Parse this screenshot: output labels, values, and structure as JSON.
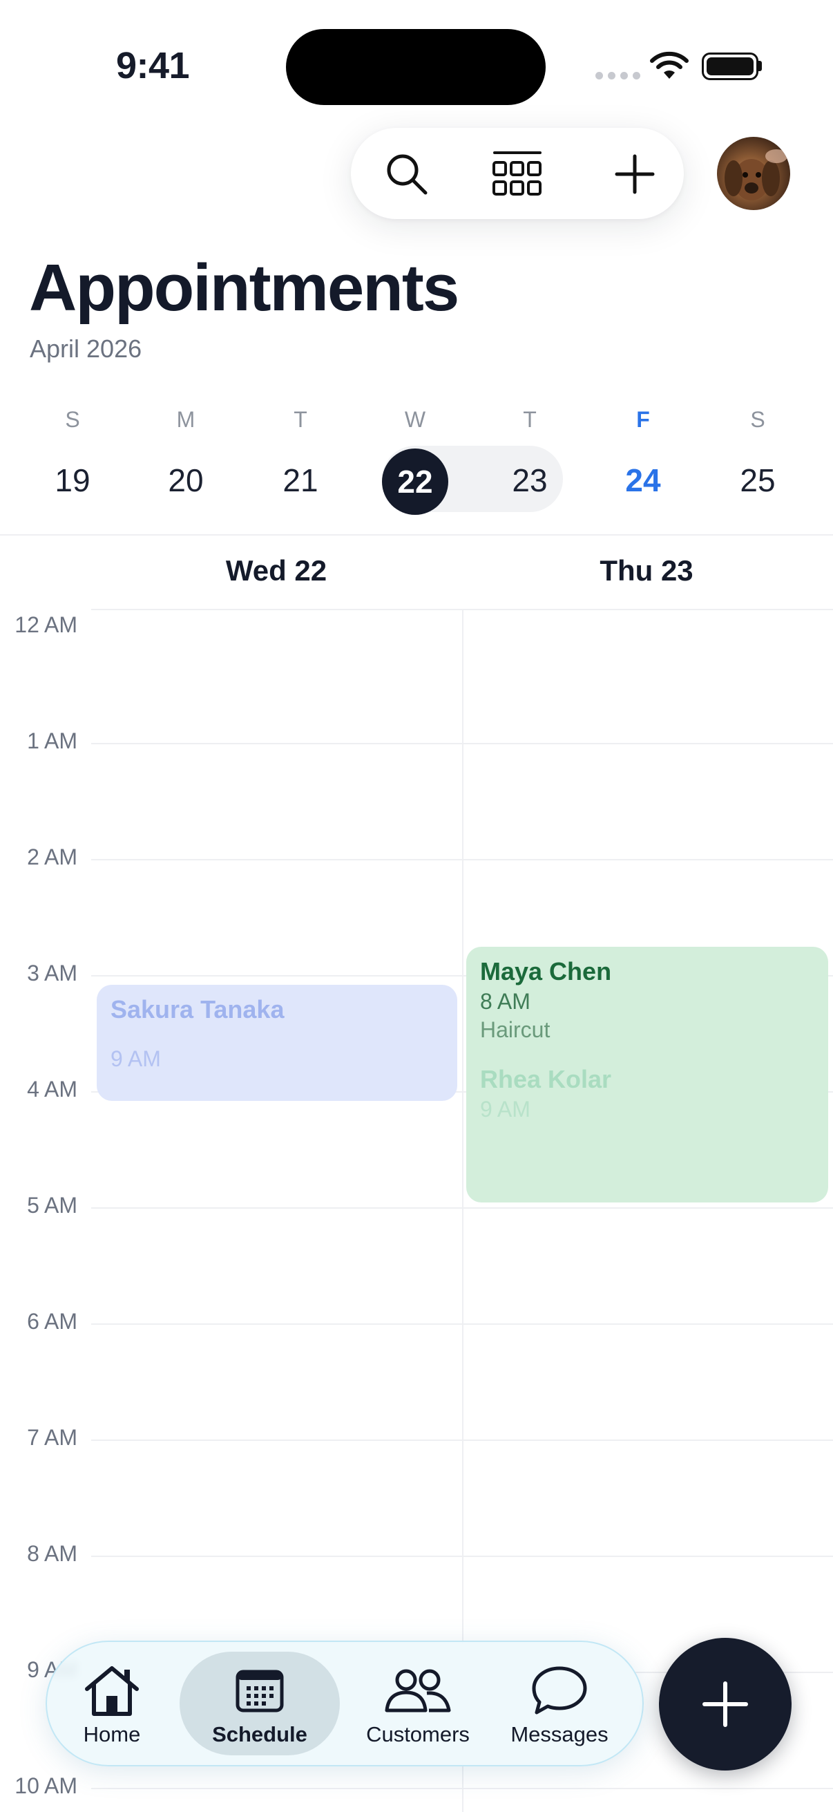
{
  "status_bar": {
    "time": "9:41"
  },
  "header": {
    "title": "Appointments",
    "subtitle": "April 2026"
  },
  "toolbar": {
    "icons": [
      "search-icon",
      "grid-view-icon",
      "plus-icon"
    ],
    "avatar": "profile-avatar"
  },
  "week": {
    "days": [
      {
        "letter": "S",
        "number": "19"
      },
      {
        "letter": "M",
        "number": "20"
      },
      {
        "letter": "T",
        "number": "21"
      },
      {
        "letter": "W",
        "number": "22"
      },
      {
        "letter": "T",
        "number": "23"
      },
      {
        "letter": "F",
        "number": "24"
      },
      {
        "letter": "S",
        "number": "25"
      }
    ],
    "selected": "22",
    "today": "24",
    "accent_color": "#2a73e8"
  },
  "columns": [
    {
      "label": "Wed 22"
    },
    {
      "label": "Thu 23"
    }
  ],
  "hours": [
    "12 AM",
    "1 AM",
    "2 AM",
    "3 AM",
    "4 AM",
    "5 AM",
    "6 AM",
    "7 AM",
    "8 AM",
    "9 AM",
    "10 AM"
  ],
  "events": [
    {
      "name": "Maya Chen",
      "time": "8 AM",
      "service": "Haircut",
      "color": "#d3eedb"
    },
    {
      "name": "Sakura Tanaka",
      "time": "9 AM",
      "color": "#dfe6fb"
    },
    {
      "name": "Rhea Kolar",
      "time": "9 AM",
      "color": "#d3eedb"
    }
  ],
  "tabbar": {
    "tabs": [
      {
        "label": "Home",
        "icon": "home-icon"
      },
      {
        "label": "Schedule",
        "icon": "calendar-icon",
        "active": true
      },
      {
        "label": "Customers",
        "icon": "customers-icon"
      },
      {
        "label": "Messages",
        "icon": "messages-icon"
      }
    ]
  },
  "fab": {
    "icon": "plus-icon"
  }
}
